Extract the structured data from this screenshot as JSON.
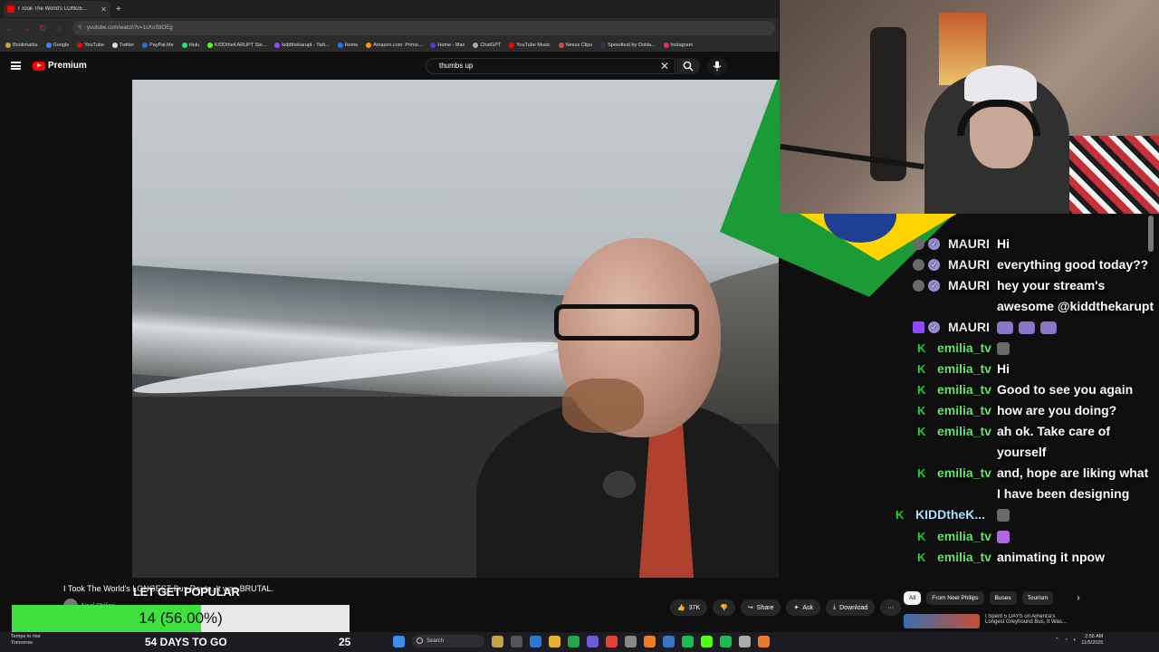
{
  "browser": {
    "tab_title": "I Took The World's LONGE...",
    "url": "youtube.com/watch?v=1sXoS8OEg",
    "bookmarks": [
      "Bookmarks",
      "Google",
      "YouTube",
      "Twitter",
      "PayPal.Me",
      "Hulu",
      "KIDDtheKARUPT Ste...",
      "kiddthekarupt - Twit...",
      "Home",
      "Amazon.com: Prime...",
      "Home - Max",
      "ChatGPT",
      "YouTube Music",
      "Nexus Clips",
      "Speedtest by Ookla...",
      "Instagram"
    ]
  },
  "youtube": {
    "brand": "Premium",
    "search_value": "thumbs up",
    "video_title": "I Took The World's LONGEST Bus Route, It was BRUTAL.",
    "channel_name": "Noel Philips",
    "actions": {
      "likes": "37K",
      "share": "Share",
      "ask": "Ask",
      "download": "Download"
    },
    "chips": [
      "All",
      "From Noel Philips",
      "Buses",
      "Tourism"
    ],
    "rec_title": "I Spent 5 DAYS on America's Longest Greyhound Bus, It Was..."
  },
  "chat": {
    "messages": [
      {
        "user": "MAURI",
        "text": "Hi",
        "badges": [
          "sub",
          "mod"
        ]
      },
      {
        "user": "MAURI",
        "text": "everything good today??",
        "badges": [
          "sub",
          "mod"
        ]
      },
      {
        "user": "MAURI",
        "text": "hey your stream's awesome @kiddthekarupt",
        "badges": [
          "sub",
          "mod"
        ]
      },
      {
        "user": "MAURI",
        "text": "",
        "badges": [
          "twitch",
          "mod"
        ],
        "emotes": 3
      },
      {
        "user": "emilia_tv",
        "text": "",
        "badges": [
          "kick"
        ],
        "emotes": 1
      },
      {
        "user": "emilia_tv",
        "text": "Hi",
        "badges": [
          "kick"
        ]
      },
      {
        "user": "emilia_tv",
        "text": "Good to see you again",
        "badges": [
          "kick"
        ]
      },
      {
        "user": "emilia_tv",
        "text": "how are you doing?",
        "badges": [
          "kick"
        ]
      },
      {
        "user": "emilia_tv",
        "text": "ah ok. Take care of yourself",
        "badges": [
          "kick"
        ]
      },
      {
        "user": "emilia_tv",
        "text": "and, hope are liking what I have been designing",
        "badges": [
          "kick"
        ]
      },
      {
        "user": "KIDDtheK...",
        "text": "",
        "badges": [
          "kick"
        ],
        "emotes": 1
      },
      {
        "user": "emilia_tv",
        "text": "",
        "badges": [
          "kick"
        ],
        "emotes": 1
      },
      {
        "user": "emilia_tv",
        "text": "animating it npow",
        "badges": [
          "kick"
        ]
      }
    ]
  },
  "goal": {
    "label": "LET GET POPULAR",
    "progress_text": "14 (56.00%)",
    "progress_fraction": 0.56,
    "days_left": "54 DAYS TO GO",
    "target": "25"
  },
  "taskbar": {
    "weather_line1": "Temps to rise",
    "weather_line2": "Tomorrow",
    "search": "Search",
    "time": "2:55 AM",
    "date": "11/5/2025"
  },
  "colors": {
    "youtube_red": "#ff0000",
    "kick_green": "#22d13a",
    "goal_fill": "#3fe13e",
    "emilia_name": "#68e36a"
  }
}
